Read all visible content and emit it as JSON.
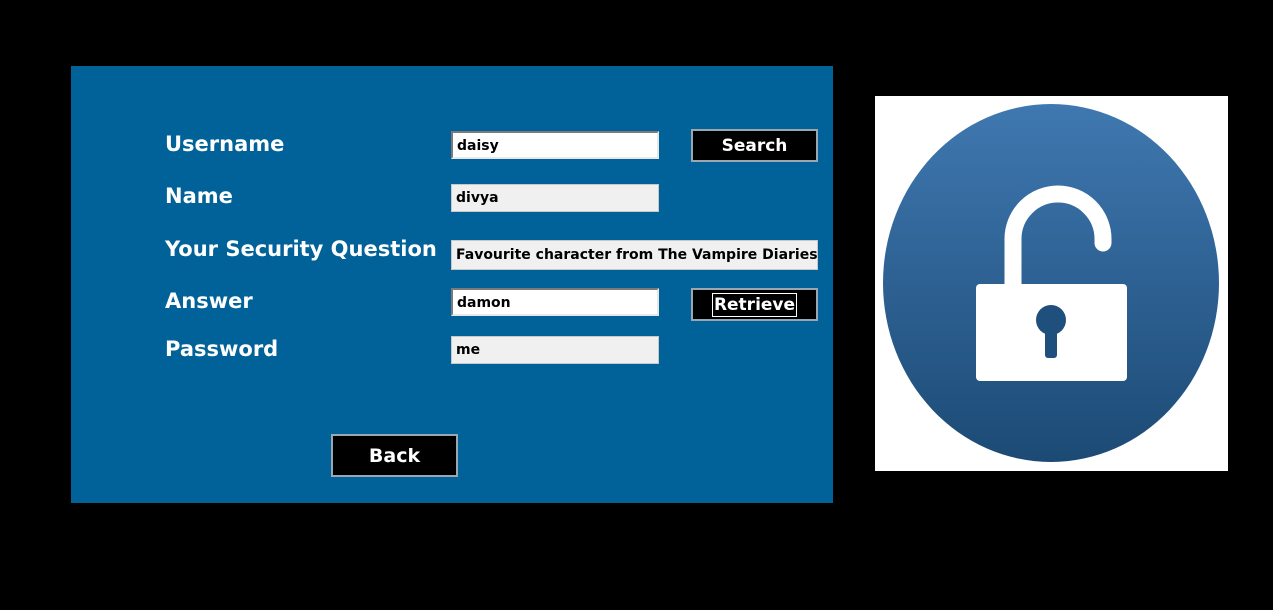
{
  "form": {
    "username_label": "Username",
    "name_label": "Name",
    "security_question_label": "Your Security Question",
    "answer_label": "Answer",
    "password_label": "Password",
    "username_value": "daisy",
    "name_value": "divya",
    "security_question_value": "Favourite character from The Vampire Diaries",
    "answer_value": "damon",
    "password_value": "me"
  },
  "buttons": {
    "search_label": "Search",
    "retrieve_label": "Retrieve",
    "back_label": "Back"
  },
  "icon": {
    "name": "unlock-icon",
    "colors": {
      "circle_top": "#3f78b0",
      "circle_bottom": "#1c4a75",
      "glyph": "#ffffff"
    }
  },
  "colors": {
    "background": "#000000",
    "panel": "#006298",
    "button": "#000000",
    "label_text": "#ffffff"
  }
}
